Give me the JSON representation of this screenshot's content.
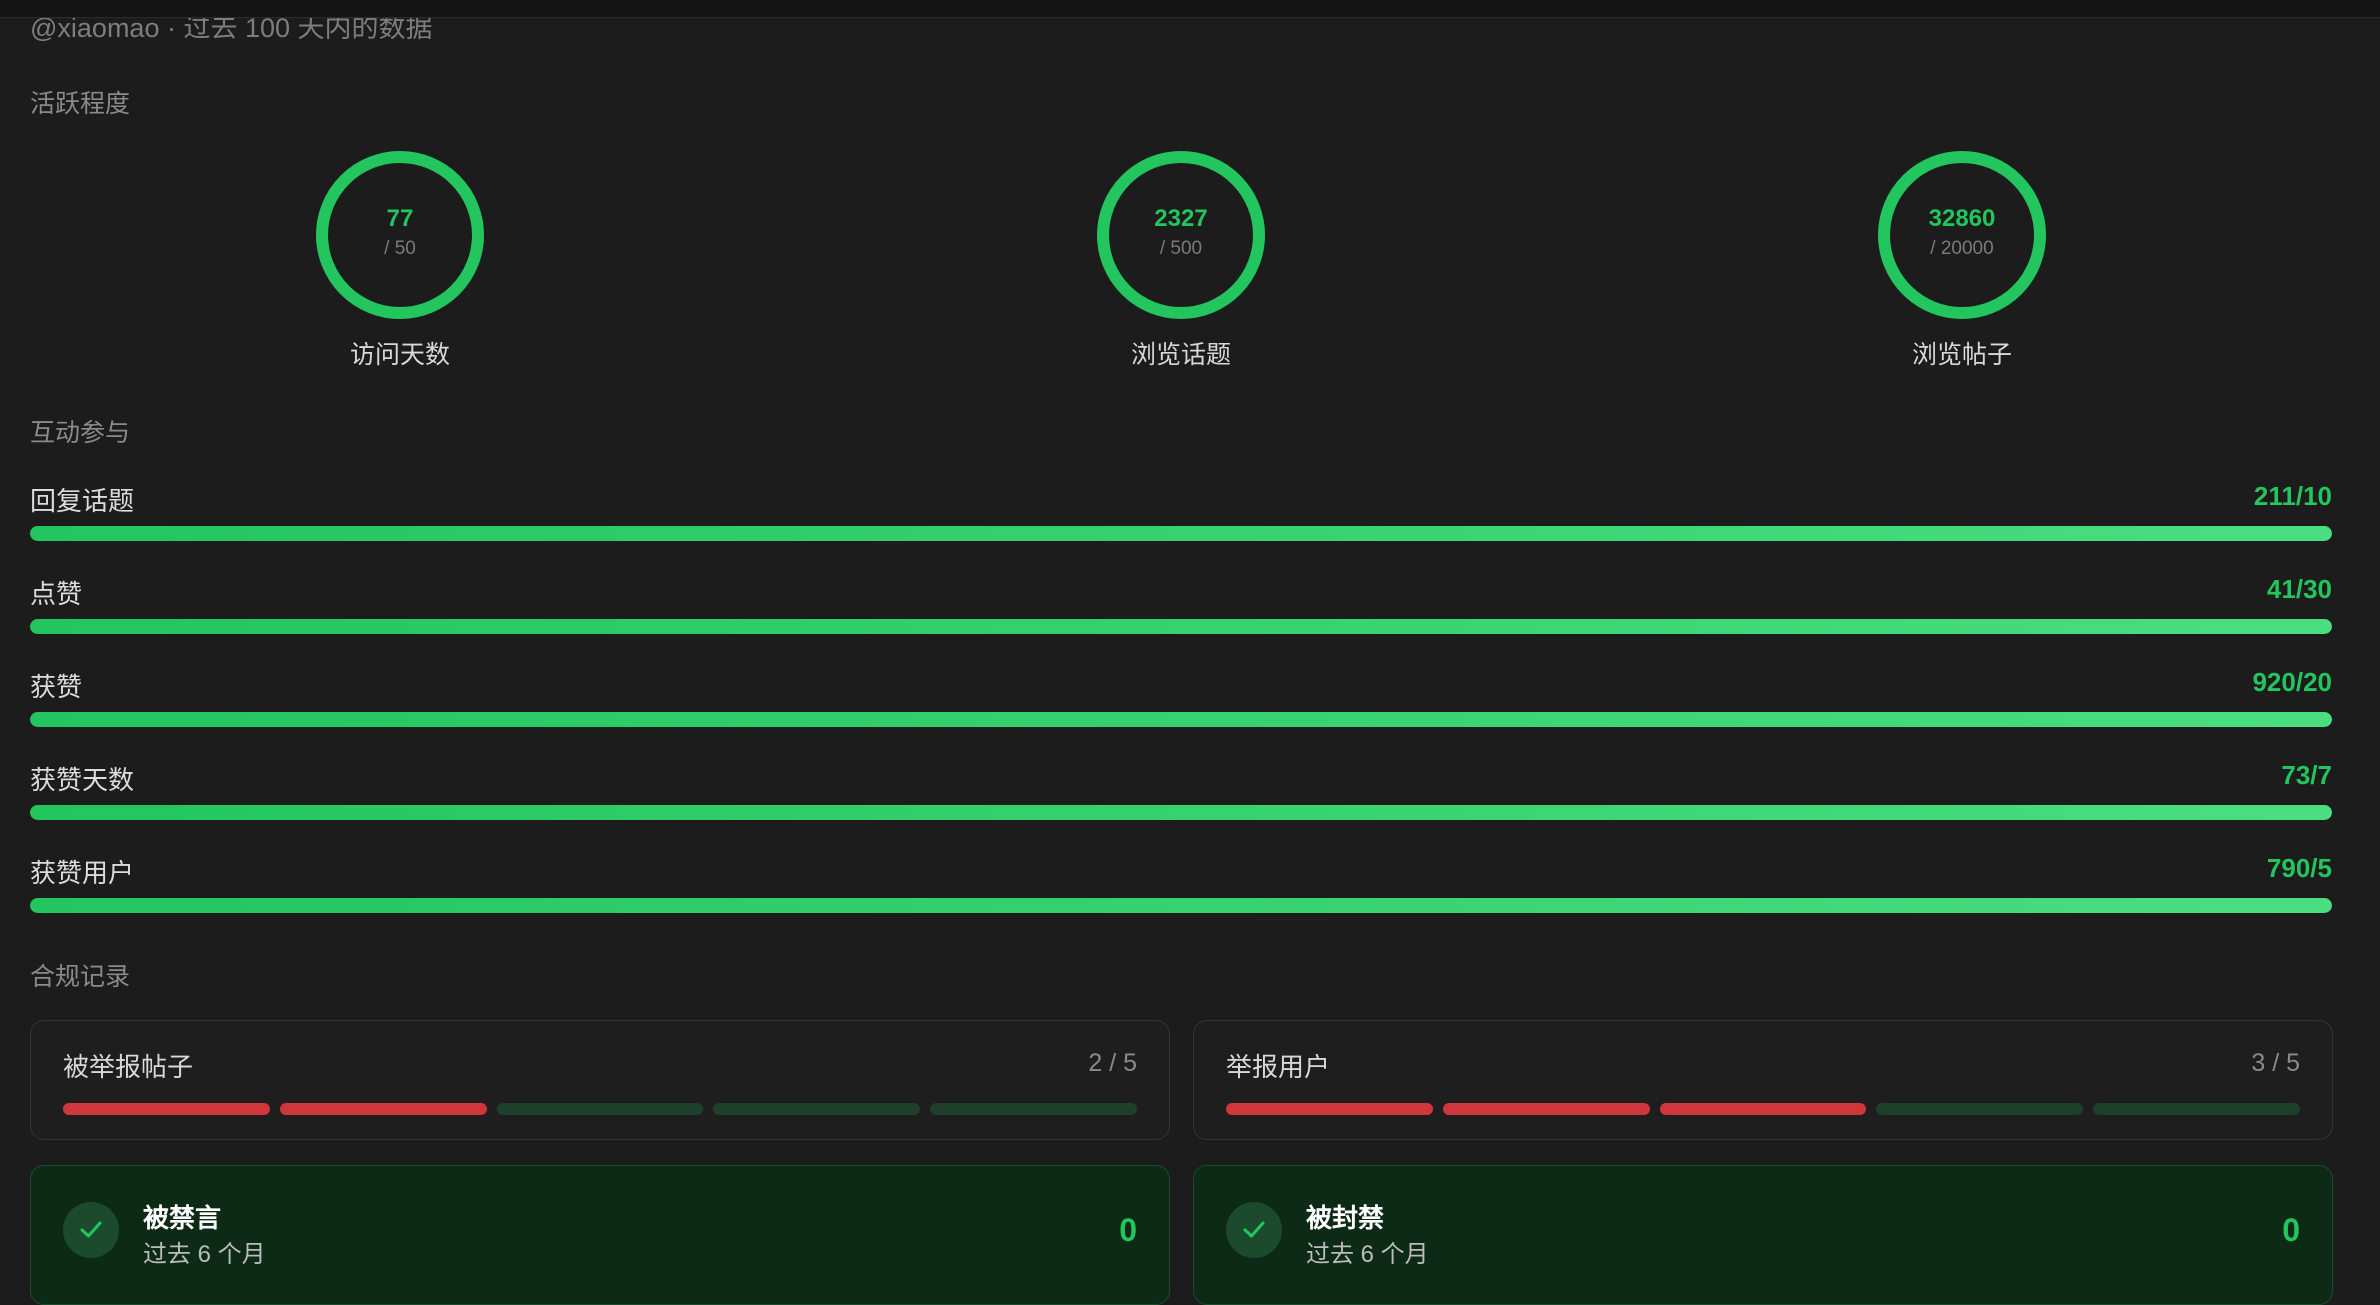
{
  "header": {
    "subtitle": "@xiaomao · 过去 100 天内的数据"
  },
  "colors": {
    "accent": "#22c55e",
    "danger": "#d2363d",
    "background": "#1c1c1c"
  },
  "activity": {
    "title": "活跃程度",
    "rings": [
      {
        "value": "77",
        "target": "/ 50",
        "label": "访问天数",
        "progress": 1.0
      },
      {
        "value": "2327",
        "target": "/ 500",
        "label": "浏览话题",
        "progress": 1.0
      },
      {
        "value": "32860",
        "target": "/ 20000",
        "label": "浏览帖子",
        "progress": 1.0
      }
    ]
  },
  "engagement": {
    "title": "互动参与",
    "items": [
      {
        "label": "回复话题",
        "value": "211/10",
        "progress": 1.0
      },
      {
        "label": "点赞",
        "value": "41/30",
        "progress": 1.0
      },
      {
        "label": "获赞",
        "value": "920/20",
        "progress": 1.0
      },
      {
        "label": "获赞天数",
        "value": "73/7",
        "progress": 1.0
      },
      {
        "label": "获赞用户",
        "value": "790/5",
        "progress": 1.0
      }
    ]
  },
  "compliance": {
    "title": "合规记录",
    "reports": [
      {
        "title": "被举报帖子",
        "count": "2 / 5",
        "filled": 2,
        "total": 5
      },
      {
        "title": "举报用户",
        "count": "3 / 5",
        "filled": 3,
        "total": 5
      }
    ],
    "statuses": [
      {
        "title": "被禁言",
        "subtitle": "过去 6 个月",
        "value": "0",
        "icon": "check-icon"
      },
      {
        "title": "被封禁",
        "subtitle": "过去 6 个月",
        "value": "0",
        "icon": "check-icon"
      }
    ]
  }
}
